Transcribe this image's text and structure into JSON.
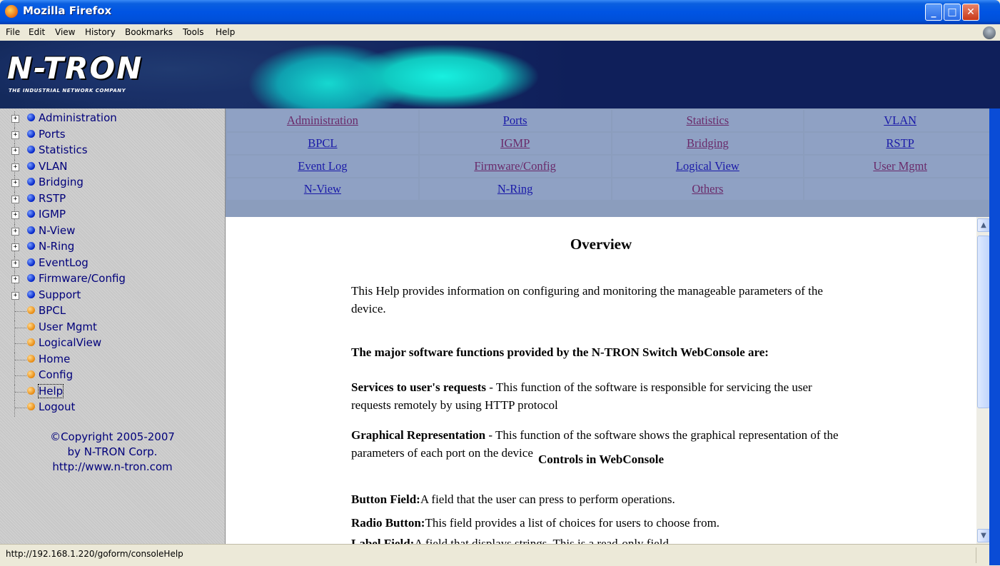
{
  "window": {
    "title": "Mozilla Firefox"
  },
  "menubar": {
    "items": [
      "File",
      "Edit",
      "View",
      "History",
      "Bookmarks",
      "Tools",
      "Help"
    ]
  },
  "banner": {
    "logo": "N-TRON",
    "tagline": "THE INDUSTRIAL NETWORK COMPANY"
  },
  "sidebar": {
    "items": [
      {
        "label": "Administration",
        "type": "folder"
      },
      {
        "label": "Ports",
        "type": "folder"
      },
      {
        "label": "Statistics",
        "type": "folder"
      },
      {
        "label": "VLAN",
        "type": "folder"
      },
      {
        "label": "Bridging",
        "type": "folder"
      },
      {
        "label": "RSTP",
        "type": "folder"
      },
      {
        "label": "IGMP",
        "type": "folder"
      },
      {
        "label": "N-View",
        "type": "folder"
      },
      {
        "label": "N-Ring",
        "type": "folder"
      },
      {
        "label": "EventLog",
        "type": "folder"
      },
      {
        "label": "Firmware/Config",
        "type": "folder"
      },
      {
        "label": "Support",
        "type": "folder"
      },
      {
        "label": "BPCL",
        "type": "page"
      },
      {
        "label": "User Mgmt",
        "type": "page"
      },
      {
        "label": "LogicalView",
        "type": "page"
      },
      {
        "label": "Home",
        "type": "page"
      },
      {
        "label": "Config",
        "type": "page"
      },
      {
        "label": "Help",
        "type": "page",
        "focused": true
      },
      {
        "label": "Logout",
        "type": "page"
      }
    ],
    "copyright": [
      "©Copyright 2005-2007",
      "by N-TRON Corp.",
      "http://www.n-tron.com"
    ]
  },
  "nav": {
    "rows": [
      [
        {
          "label": "Administration",
          "visited": true
        },
        {
          "label": "Ports"
        },
        {
          "label": "Statistics",
          "visited": true
        },
        {
          "label": "VLAN"
        }
      ],
      [
        {
          "label": "BPCL"
        },
        {
          "label": "IGMP",
          "visited": true
        },
        {
          "label": "Bridging",
          "visited": true
        },
        {
          "label": "RSTP"
        }
      ],
      [
        {
          "label": "Event Log"
        },
        {
          "label": "Firmware/Config",
          "visited": true
        },
        {
          "label": "Logical View"
        },
        {
          "label": "User Mgmt",
          "visited": true
        }
      ],
      [
        {
          "label": "N-View"
        },
        {
          "label": "N-Ring"
        },
        {
          "label": "Others",
          "visited": true
        },
        {
          "label": ""
        }
      ]
    ]
  },
  "content": {
    "title": "Overview",
    "intro": "This Help provides information on configuring and monitoring the manageable parameters of the device.",
    "functions_heading": "The major software functions provided by the N-TRON Switch WebConsole are:",
    "services_term": "Services to user's requests",
    "services_desc": " - This function of the software is responsible for servicing the user requests remotely by using HTTP protocol",
    "graphical_term": "Graphical Representation",
    "graphical_desc": " - This function of the software shows the graphical representation of the parameters of each port on the device",
    "controls_heading": "Controls in WebConsole",
    "button_term": "Button Field:",
    "button_desc": "A field that the user can press to perform operations.",
    "radio_term": "Radio Button:",
    "radio_desc": "This field provides a list of choices for users to choose from.",
    "label_term": "Label Field:",
    "label_desc": "A field that displays strings. This is a read-only field."
  },
  "statusbar": {
    "text": "http://192.168.1.220/goform/consoleHelp"
  }
}
